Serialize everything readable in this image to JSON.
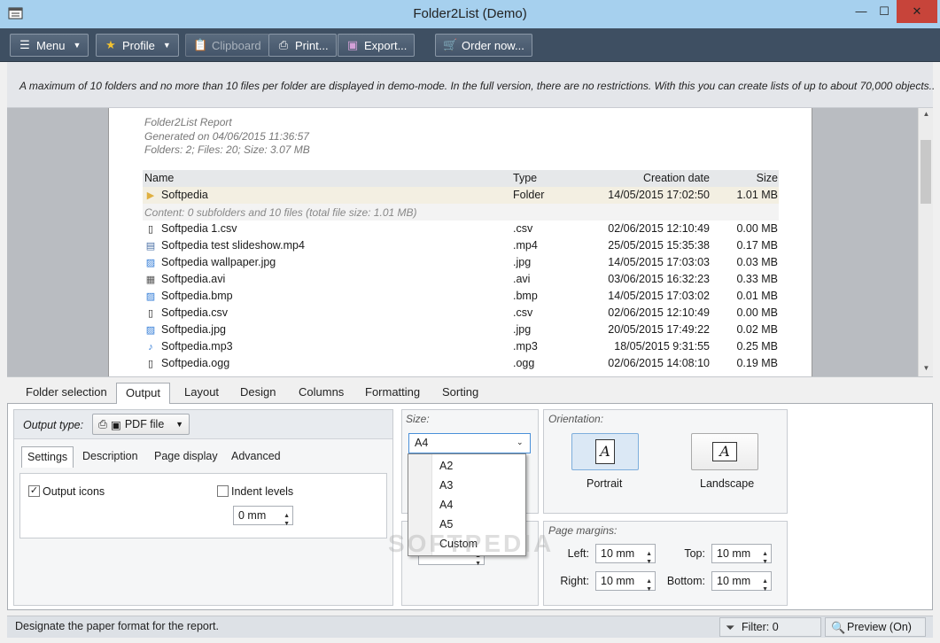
{
  "window": {
    "title": "Folder2List (Demo)",
    "min": "—",
    "max": "☐",
    "close": "✕"
  },
  "toolbar": {
    "menu": "Menu",
    "profile": "Profile",
    "clipboard": "Clipboard",
    "print": "Print...",
    "export": "Export...",
    "order": "Order now..."
  },
  "banner": "A maximum of 10 folders and no more than 10 files per folder are displayed in demo-mode. In the full version, there are no restrictions. With this you can create lists of up to about 70,000 objects..",
  "report": {
    "title": "Folder2List Report",
    "generated": "Generated on 04/06/2015 11:36:57",
    "summary": "Folders: 2;  Files: 20;  Size: 3.07 MB",
    "columns": {
      "name": "Name",
      "type": "Type",
      "date": "Creation date",
      "size": "Size"
    },
    "folder": {
      "name": "Softpedia",
      "type": "Folder",
      "date": "14/05/2015 17:02:50",
      "size": "1.01 MB"
    },
    "content": "Content: 0 subfolders and 10 files (total file size: 1.01 MB)",
    "files": [
      {
        "name": "Softpedia 1.csv",
        "type": ".csv",
        "date": "02/06/2015 12:10:49",
        "size": "0.00 MB"
      },
      {
        "name": "Softpedia test slideshow.mp4",
        "type": ".mp4",
        "date": "25/05/2015 15:35:38",
        "size": "0.17 MB"
      },
      {
        "name": "Softpedia wallpaper.jpg",
        "type": ".jpg",
        "date": "14/05/2015 17:03:03",
        "size": "0.03 MB"
      },
      {
        "name": "Softpedia.avi",
        "type": ".avi",
        "date": "03/06/2015 16:32:23",
        "size": "0.33 MB"
      },
      {
        "name": "Softpedia.bmp",
        "type": ".bmp",
        "date": "14/05/2015 17:03:02",
        "size": "0.01 MB"
      },
      {
        "name": "Softpedia.csv",
        "type": ".csv",
        "date": "02/06/2015 12:10:49",
        "size": "0.00 MB"
      },
      {
        "name": "Softpedia.jpg",
        "type": ".jpg",
        "date": "20/05/2015 17:49:22",
        "size": "0.02 MB"
      },
      {
        "name": "Softpedia.mp3",
        "type": ".mp3",
        "date": "18/05/2015 9:31:55",
        "size": "0.25 MB"
      },
      {
        "name": "Softpedia.ogg",
        "type": ".ogg",
        "date": "02/06/2015 14:08:10",
        "size": "0.19 MB"
      }
    ]
  },
  "tabs": [
    "Folder selection",
    "Output",
    "Layout",
    "Design",
    "Columns",
    "Formatting",
    "Sorting"
  ],
  "output": {
    "type_label": "Output type:",
    "type_value": "PDF file",
    "subtabs": [
      "Settings",
      "Description",
      "Page display",
      "Advanced"
    ],
    "output_icons": "Output icons",
    "indent_levels": "Indent levels",
    "indent_value": "0 mm"
  },
  "size": {
    "label": "Size:",
    "selected": "A4",
    "options": [
      "A2",
      "A3",
      "A4",
      "A5",
      "Custom"
    ]
  },
  "orientation": {
    "label": "Orientation:",
    "portrait": "Portrait",
    "landscape": "Landscape",
    "glyph": "A"
  },
  "margins": {
    "label": "Page margins:",
    "left_label": "Left:",
    "left": "10 mm",
    "top_label": "Top:",
    "top": "10 mm",
    "right_label": "Right:",
    "right": "10 mm",
    "bottom_label": "Bottom:",
    "bottom": "10 mm"
  },
  "watermark": "SOFTPEDIA",
  "status": {
    "text": "Designate the paper format for the report.",
    "filter": "Filter: 0",
    "preview": "Preview (On)"
  }
}
